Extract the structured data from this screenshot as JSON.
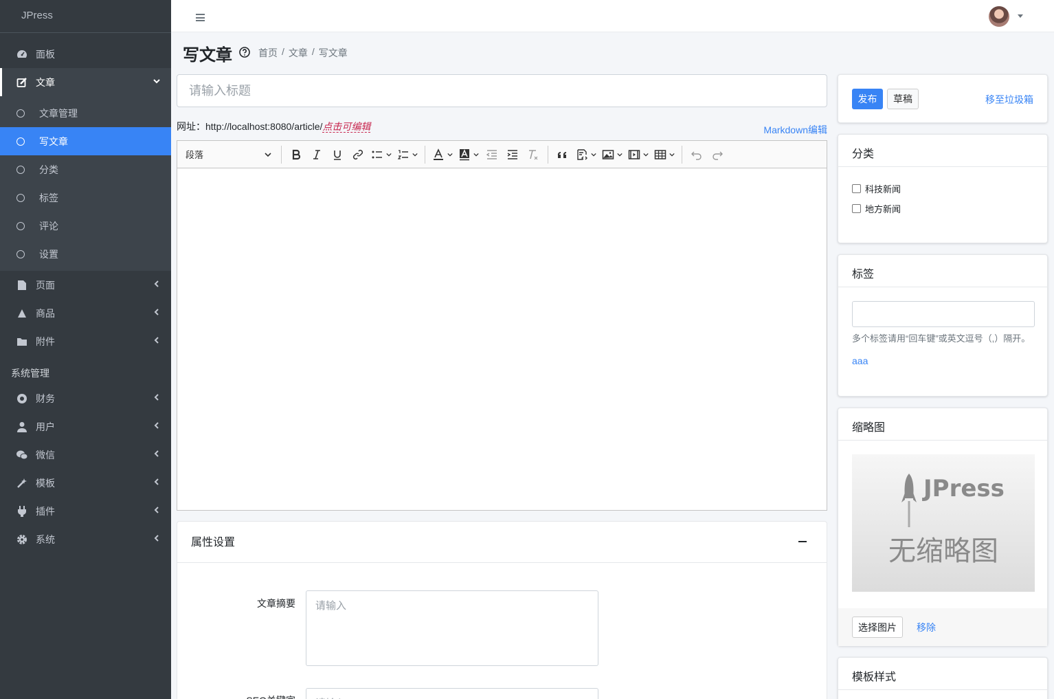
{
  "brand": "JPress",
  "sidebar": {
    "items": [
      {
        "label": "面板",
        "icon": "dashboard-icon"
      },
      {
        "label": "文章",
        "icon": "edit-icon",
        "open": true,
        "children": [
          {
            "label": "文章管理"
          },
          {
            "label": "写文章",
            "active": true
          },
          {
            "label": "分类"
          },
          {
            "label": "标签"
          },
          {
            "label": "评论"
          },
          {
            "label": "设置"
          }
        ]
      },
      {
        "label": "页面",
        "icon": "file-icon"
      },
      {
        "label": "商品",
        "icon": "product-icon"
      },
      {
        "label": "附件",
        "icon": "folder-icon"
      }
    ],
    "section_header": "系统管理",
    "system_items": [
      {
        "label": "财务",
        "icon": "finance-icon"
      },
      {
        "label": "用户",
        "icon": "user-icon"
      },
      {
        "label": "微信",
        "icon": "wechat-icon"
      },
      {
        "label": "模板",
        "icon": "template-icon"
      },
      {
        "label": "插件",
        "icon": "plugin-icon"
      },
      {
        "label": "系统",
        "icon": "gear-icon"
      }
    ]
  },
  "header": {
    "title": "写文章",
    "breadcrumb": [
      "首页",
      "/",
      "文章",
      "/",
      "写文章"
    ]
  },
  "editor": {
    "title_placeholder": "请输入标题",
    "url_label": "网址：http://localhost:8080/article/",
    "url_edit_link": "点击可编辑",
    "markdown_link": "Markdown编辑",
    "paragraph_select": "段落"
  },
  "properties": {
    "title": "属性设置",
    "summary_label": "文章摘要",
    "summary_placeholder": "请输入",
    "seo_label": "SEO关键字",
    "seo_placeholder": "请输入"
  },
  "publish": {
    "publish_btn": "发布",
    "draft_btn": "草稿",
    "trash_link": "移至垃圾箱"
  },
  "category": {
    "title": "分类",
    "options": [
      "科技新闻",
      "地方新闻"
    ]
  },
  "tags": {
    "title": "标签",
    "help": "多个标签请用“回车键”或英文逗号（,）隔开。",
    "existing": [
      "aaa"
    ]
  },
  "thumbnail": {
    "title": "缩略图",
    "placeholder_brand": "JPress",
    "placeholder_text": "无缩略图",
    "select_btn": "选择图片",
    "remove_link": "移除"
  },
  "template": {
    "title": "模板样式"
  },
  "colors": {
    "sidebar_bg": "#343a40",
    "accent": "#3884f5",
    "url_edit": "#c7254e"
  }
}
